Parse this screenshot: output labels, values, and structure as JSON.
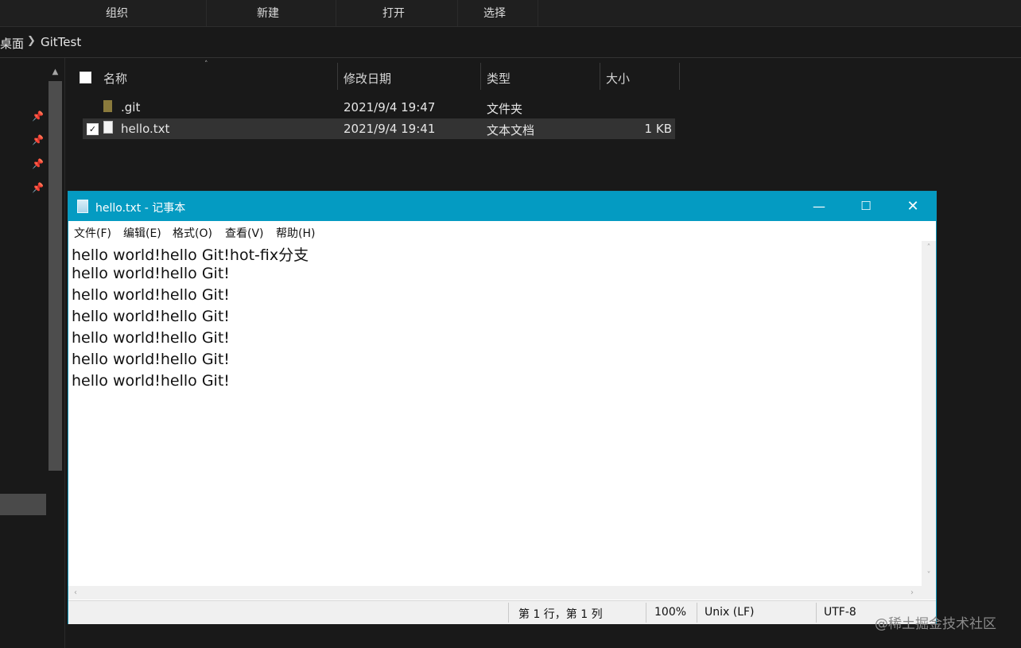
{
  "explorer": {
    "ribbon": [
      "组织",
      "新建",
      "打开",
      "选择"
    ],
    "breadcrumb": {
      "parent": "桌面",
      "current": "GitTest"
    },
    "columns": {
      "name": "名称",
      "date": "修改日期",
      "type": "类型",
      "size": "大小"
    },
    "files": [
      {
        "name": ".git",
        "date": "2021/9/4 19:47",
        "type": "文件夹",
        "size": "",
        "icon": "folder-icon",
        "selected": false
      },
      {
        "name": "hello.txt",
        "date": "2021/9/4 19:41",
        "type": "文本文档",
        "size": "1 KB",
        "icon": "text-file-icon",
        "selected": true
      }
    ]
  },
  "notepad": {
    "title": "hello.txt - 记事本",
    "menu": [
      "文件(F)",
      "编辑(E)",
      "格式(O)",
      "查看(V)",
      "帮助(H)"
    ],
    "lines": [
      "hello world!hello Git!hot-fix分支",
      "hello world!hello Git!",
      "hello world!hello Git!",
      "hello world!hello Git!",
      "hello world!hello Git!",
      "hello world!hello Git!",
      "hello world!hello Git!"
    ],
    "status": {
      "position": "第 1 行，第 1 列",
      "zoom": "100%",
      "line_ending": "Unix (LF)",
      "encoding": "UTF-8"
    }
  },
  "watermark": "@稀土掘金技术社区",
  "colors": {
    "titlebar": "#049bc2",
    "explorer_bg": "#191919",
    "selection": "#333333"
  }
}
